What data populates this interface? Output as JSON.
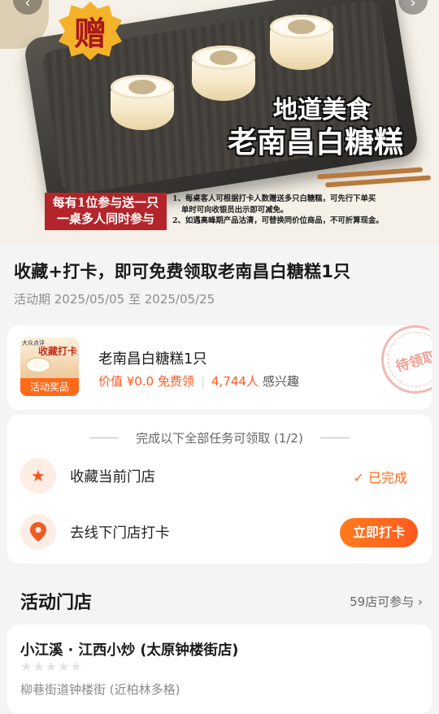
{
  "hero": {
    "badge": "赠",
    "dish_line1": "地道美食",
    "dish_line2": "老南昌白糖糕",
    "promo_line1": "每有1位参与送一只",
    "promo_line2": "一桌多人同时参与",
    "rule1_a": "1、每桌客人可根据打卡人数赠送多只白糖糕，可先行下单买",
    "rule1_b": "单时可向收银员出示即可减免。",
    "rule2": "2、如遇高峰期产品沽清，可替换同价位商品，不可折算现金。"
  },
  "activity": {
    "title": "收藏+打卡，即可免费领取老南昌白糖糕1只",
    "period": "活动期 2025/05/05 至 2025/05/25"
  },
  "prize": {
    "thumb_brand": "大众点评",
    "thumb_title": "收藏打卡",
    "thumb_label": "活动奖品",
    "name": "老南昌白糖糕1只",
    "value": "价值 ¥0.0 免费领",
    "interest_count": "4,744人",
    "interest_label": "感兴趣",
    "stamp": "待领取"
  },
  "tasks": {
    "header": "完成以下全部任务可领取 (1/2)",
    "items": [
      {
        "label": "收藏当前门店",
        "status": "✓ 已完成",
        "icon": "star-icon"
      },
      {
        "label": "去线下门店打卡",
        "action": "立即打卡",
        "icon": "location-pin-icon"
      }
    ]
  },
  "stores": {
    "title": "活动门店",
    "count": "59店可参与 ›",
    "store": {
      "name": "小江溪 · 江西小炒 (太原钟楼街店)",
      "stars": "★★★★★",
      "address": "柳巷街道钟楼街 (近柏林多格)"
    }
  },
  "colors": {
    "accent": "#ff5a1f",
    "accent_light": "#fdeee5",
    "stamp": "#f2b8b0"
  }
}
